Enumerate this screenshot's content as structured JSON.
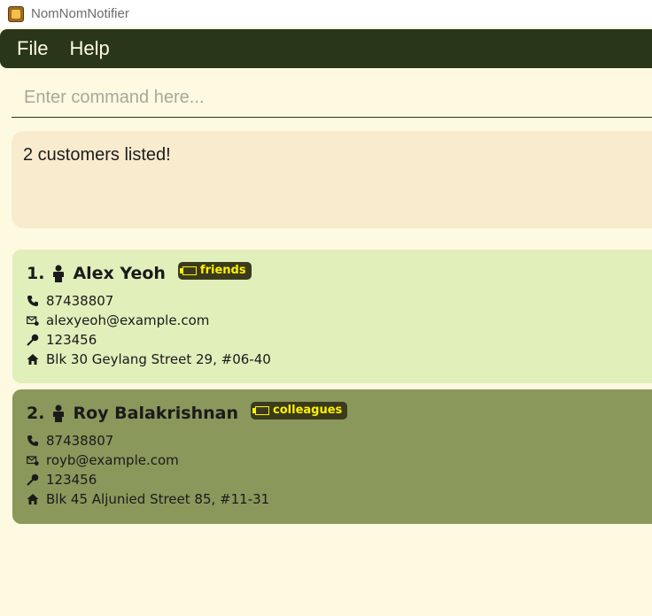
{
  "window": {
    "title": "NomNomNotifier"
  },
  "menu": [
    {
      "label": "File"
    },
    {
      "label": "Help"
    }
  ],
  "command": {
    "placeholder": "Enter command here..."
  },
  "result": {
    "text": "2 customers listed!"
  },
  "customers": [
    {
      "index": "1.",
      "name": "Alex Yeoh",
      "tag": "friends",
      "phone": "87438807",
      "email": "alexyeoh@example.com",
      "postal": "123456",
      "address": "Blk 30 Geylang Street 29, #06-40"
    },
    {
      "index": "2.",
      "name": "Roy Balakrishnan",
      "tag": "colleagues",
      "phone": "87438807",
      "email": "royb@example.com",
      "postal": "123456",
      "address": "Blk 45 Aljunied Street 85, #11-31"
    }
  ],
  "icons": {
    "person": "person-icon",
    "tag": "tag-icon",
    "phone": "phone-icon",
    "email": "email-icon",
    "postal": "pin-icon",
    "address": "home-icon"
  },
  "colors": {
    "menubar": "#2a3619",
    "background": "#fef9e1",
    "result_box": "#f9ebce",
    "card_1": "#e1efbb",
    "card_2": "#8a985c",
    "tag_bg": "#3b3b1c",
    "tag_text": "#fff200"
  }
}
